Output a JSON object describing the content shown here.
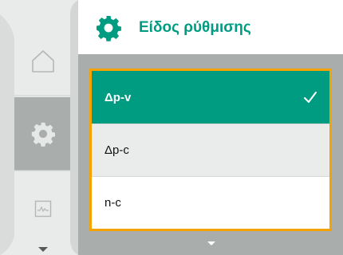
{
  "header": {
    "title": "Είδος ρύθμισης",
    "icon": "gear-icon"
  },
  "rail": {
    "items": [
      {
        "icon": "home-icon"
      },
      {
        "icon": "gear-icon",
        "active": true
      },
      {
        "icon": "chart-icon"
      }
    ],
    "scroll_icon": "chevron-down-icon"
  },
  "menu": {
    "options": [
      {
        "label": "Δp-v",
        "selected": true
      },
      {
        "label": "Δp-c",
        "selected": false
      },
      {
        "label": "n-c",
        "selected": false
      }
    ],
    "scroll_icon": "chevron-down-icon"
  },
  "colors": {
    "accent": "#009c82",
    "highlight": "#f5a300",
    "rail_background": "#e9ebea",
    "panel_background": "#a9aeac"
  }
}
